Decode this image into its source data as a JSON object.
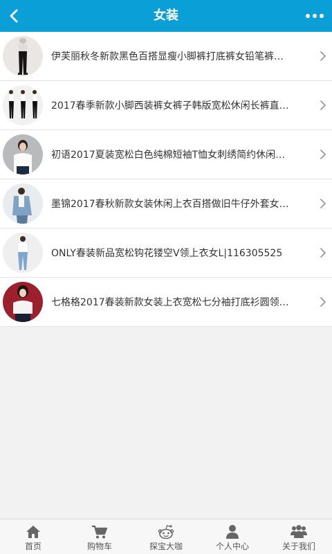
{
  "header": {
    "title": "女装",
    "back_icon": "chevron-left-icon",
    "more_icon": "more-dots-icon",
    "background": "#0a9fd6"
  },
  "products": [
    {
      "title": "伊芙丽秋冬新款黑色百搭显瘦小脚裤打底裤女铅笔裤…",
      "thumb_bg": "#e9e6e3"
    },
    {
      "title": "2017春季新款小脚西装裤女裤子韩版宽松休闲长裤直…",
      "thumb_bg": "#f1f1f1"
    },
    {
      "title": "初语2017夏装宽松白色纯棉短袖T恤女刺绣简约休闲…",
      "thumb_bg": "#b9babc"
    },
    {
      "title": "墨锦2017春秋新款女装休闲上衣百搭做旧牛仔外套女…",
      "thumb_bg": "#e8ecef"
    },
    {
      "title": "ONLY春装新品宽松钩花镂空V领上衣女L|116305525",
      "thumb_bg": "#efefef"
    },
    {
      "title": "七格格2017春装新款女装上衣宽松七分袖打底衫圆领…",
      "thumb_bg": "#9c1f2c"
    }
  ],
  "tabs": [
    {
      "label": "首页",
      "icon": "home-icon"
    },
    {
      "label": "购物车",
      "icon": "cart-icon"
    },
    {
      "label": "探宝大咖",
      "icon": "reddit-alien-icon"
    },
    {
      "label": "个人中心",
      "icon": "user-icon"
    },
    {
      "label": "关于我们",
      "icon": "group-icon"
    }
  ],
  "colors": {
    "tab_icon": "#666666",
    "chevron": "#999999"
  }
}
